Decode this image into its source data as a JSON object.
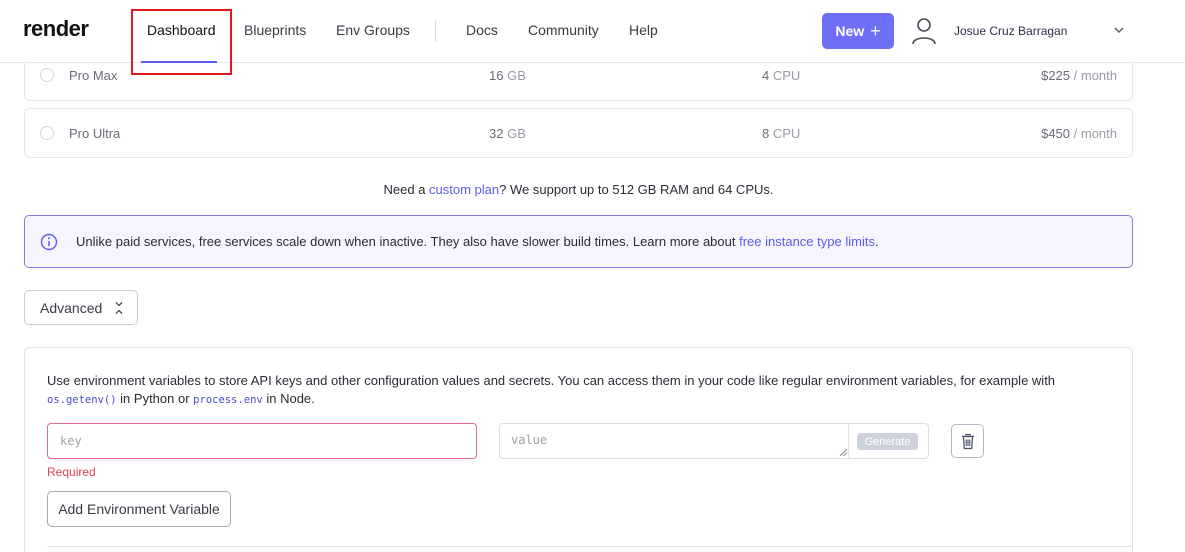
{
  "header": {
    "logo": "render",
    "nav": {
      "dashboard": "Dashboard",
      "blueprints": "Blueprints",
      "env_groups": "Env Groups",
      "docs": "Docs",
      "community": "Community",
      "help": "Help"
    },
    "new_button": "New",
    "new_button_icon": "plus-icon",
    "user_name": "Josue Cruz Barragan",
    "accent_color": "#6f6ef7",
    "highlight_color": "#e0191e"
  },
  "plans": [
    {
      "name": "Pro Max",
      "ram_value": "16",
      "ram_unit": "GB",
      "cpu_value": "4",
      "cpu_unit": "CPU",
      "price_value": "$225",
      "price_unit": "/ month"
    },
    {
      "name": "Pro Ultra",
      "ram_value": "32",
      "ram_unit": "GB",
      "cpu_value": "8",
      "cpu_unit": "CPU",
      "price_value": "$450",
      "price_unit": "/ month"
    }
  ],
  "custom_plan": {
    "prefix": "Need a",
    "link": "custom plan",
    "suffix": "? We support up to 512 GB RAM and 64 CPUs."
  },
  "info_banner": {
    "text": "Unlike paid services, free services scale down when inactive. They also have slower build times. Learn more about",
    "link": "free instance type limits",
    "suffix": ".",
    "border_color": "#8b7bd8"
  },
  "advanced": {
    "label": "Advanced"
  },
  "env": {
    "desc_part1": "Use environment variables to store API keys and other configuration values and secrets. You can access them in your code like regular environment variables, for example with",
    "code1": "os.getenv()",
    "desc_part2": "in Python or",
    "code2": "process.env",
    "desc_part3": "in Node.",
    "key_placeholder": "key",
    "value_placeholder": "value",
    "generate_label": "Generate",
    "required_label": "Required",
    "add_label": "Add Environment Variable",
    "error_color": "#e0405e"
  }
}
